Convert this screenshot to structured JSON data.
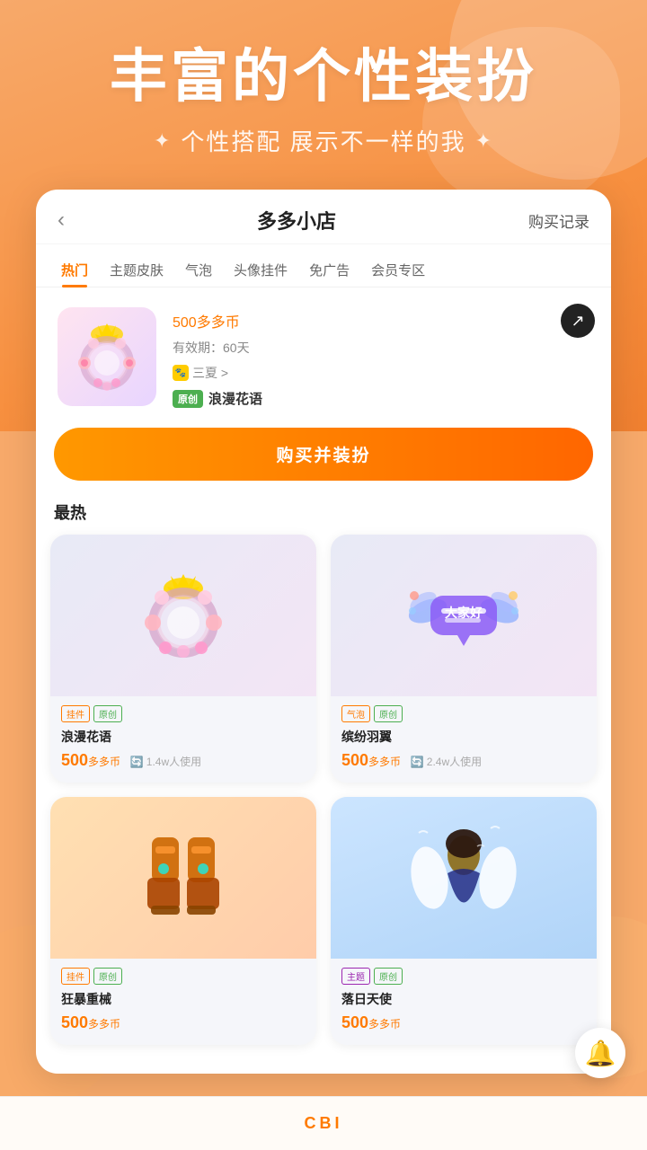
{
  "hero": {
    "title": "丰富的个性装扮",
    "subtitle": "个性搭配 展示不一样的我",
    "sparkle_left": "✦",
    "sparkle_right": "✦"
  },
  "shop": {
    "back_label": "‹",
    "title": "多多小店",
    "history_label": "购买记录",
    "tabs": [
      {
        "label": "热门",
        "active": true
      },
      {
        "label": "主题皮肤",
        "active": false
      },
      {
        "label": "气泡",
        "active": false
      },
      {
        "label": "头像挂件",
        "active": false
      },
      {
        "label": "免广告",
        "active": false
      },
      {
        "label": "会员专区",
        "active": false
      }
    ],
    "featured": {
      "price": "500",
      "currency": "多多币",
      "validity_label": "有效期：60天",
      "author_label": "三夏 >",
      "tag_original": "原创",
      "name": "浪漫花语",
      "buy_button": "购买并装扮"
    },
    "section_label": "最热",
    "items": [
      {
        "type_tag": "挂件",
        "original_tag": "原创",
        "name": "浪漫花语",
        "price": "500",
        "currency": "多多币",
        "users": "1.4w人使用",
        "bg": "light"
      },
      {
        "type_tag": "气泡",
        "original_tag": "原创",
        "name": "缤纷羽翼",
        "price": "500",
        "currency": "多多币",
        "users": "2.4w人使用",
        "bg": "light"
      },
      {
        "type_tag": "挂件",
        "original_tag": "原创",
        "name": "狂暴重械",
        "price": "500",
        "currency": "多多币",
        "users": "",
        "bg": "orange"
      },
      {
        "type_tag": "主题",
        "original_tag": "原创",
        "name": "落日天使",
        "price": "500",
        "currency": "多多币",
        "users": "",
        "bg": "blue"
      }
    ]
  },
  "bottom_bar": {
    "label": "CBI"
  },
  "float_robot": {
    "icon": "🔔"
  }
}
